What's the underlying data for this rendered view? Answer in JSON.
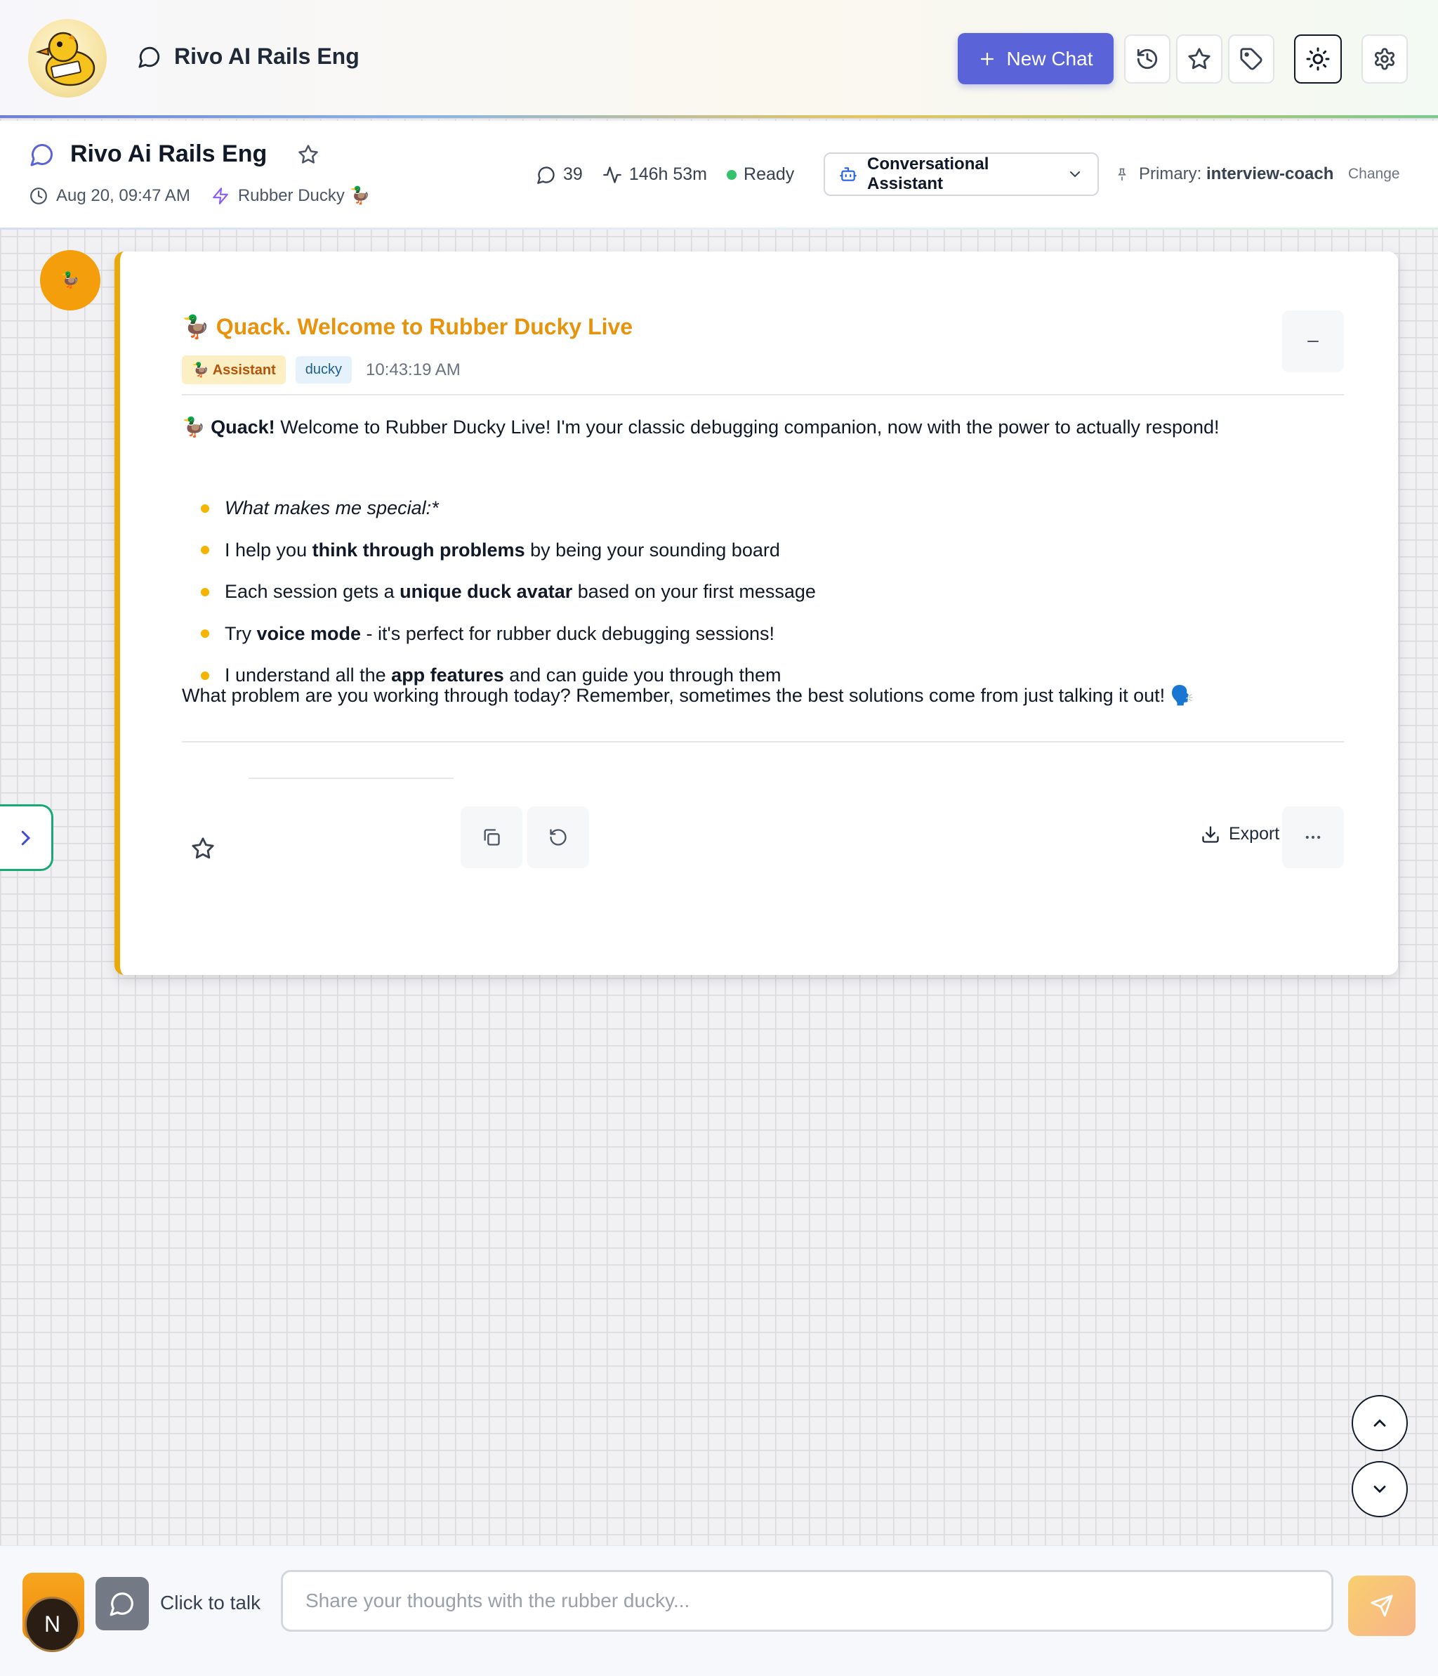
{
  "app": {
    "title": "Rivo AI Rails Eng",
    "new_chat_label": "New Chat"
  },
  "session": {
    "title": "Rivo Ai Rails Eng",
    "date": "Aug 20, 09:47 AM",
    "assistant_name": "Rubber Ducky 🦆",
    "message_count": "39",
    "duration": "146h 53m",
    "status": "Ready",
    "mode_selected": "Conversational Assistant",
    "primary_prefix": "Primary: ",
    "primary_value": "interview-coach",
    "change_label": "Change"
  },
  "message": {
    "avatar_emoji": "🦆",
    "title": "🦆 Quack. Welcome to Rubber Ducky Live",
    "role_badge": "🦆 Assistant",
    "tag_badge": "ducky",
    "timestamp": "10:43:19 AM",
    "intro_emoji": "🦆",
    "intro_bold": "Quack!",
    "intro_rest": " Welcome to Rubber Ducky Live! I'm your classic debugging companion, now with the power to actually respond!",
    "bullets": {
      "b1": "What makes me special:*",
      "b2_pre": "I help you ",
      "b2_bold": "think through problems",
      "b2_post": " by being your sounding board",
      "b3_pre": "Each session gets a ",
      "b3_bold": "unique duck avatar",
      "b3_post": " based on your first message",
      "b4_pre": "Try ",
      "b4_bold": "voice mode",
      "b4_post": " - it's perfect for rubber duck debugging sessions!",
      "b5_pre": "I understand all the ",
      "b5_bold": "app features",
      "b5_post": " and can guide you through them"
    },
    "closing": "What problem are you working through today? Remember, sometimes the best solutions come from just talking it out! 🗣️",
    "export_label": "Export"
  },
  "input": {
    "user_initial": "N",
    "click_to_talk": "Click to talk",
    "placeholder": "Share your thoughts with the rubber ducky..."
  },
  "colors": {
    "accent": "#5a63d8",
    "duck_orange": "#e8930c",
    "card_border": "#e8a909",
    "status_green": "#34c26e",
    "sidebar_toggle": "#19a974"
  },
  "icons": [
    "chat-bubble-icon",
    "plus-icon",
    "history-icon",
    "star-icon",
    "tag-icon",
    "sun-icon",
    "gear-icon",
    "clock-icon",
    "bolt-icon",
    "activity-icon",
    "bot-icon",
    "chevron-down-icon",
    "pin-icon",
    "minus-icon",
    "copy-icon",
    "refresh-icon",
    "download-icon",
    "more-icon",
    "chevron-right-icon",
    "chevron-up-icon",
    "send-icon"
  ]
}
